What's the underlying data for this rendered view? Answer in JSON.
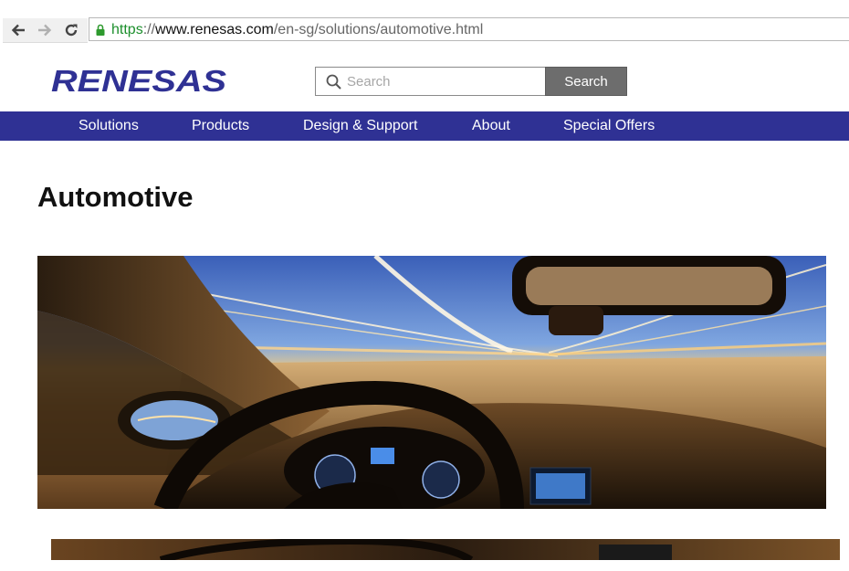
{
  "browser": {
    "url_scheme": "https",
    "url_sep": "://",
    "url_host": "www.renesas.com",
    "url_path": "/en-sg/solutions/automotive.html",
    "back_glyph": "🡐",
    "forward_glyph": "🡒",
    "reload_glyph": "↻"
  },
  "header": {
    "logo_text": "RENESAS",
    "search_placeholder": "Search",
    "search_button": "Search"
  },
  "nav": {
    "items": [
      "Solutions",
      "Products",
      "Design & Support",
      "About",
      "Special Offers"
    ]
  },
  "page": {
    "title": "Automotive"
  },
  "colors": {
    "brand_blue": "#2f3194",
    "search_button_bg": "#6d6d6d",
    "secure_green": "#1c8f2c"
  },
  "icons": {
    "back": "back-arrow-icon",
    "forward": "forward-arrow-icon",
    "reload": "reload-icon",
    "lock": "lock-icon",
    "search": "magnifier-icon"
  }
}
